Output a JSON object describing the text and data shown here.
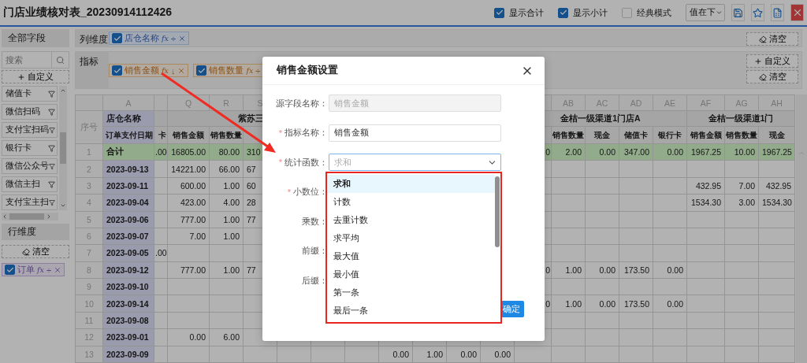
{
  "header": {
    "title": "门店业绩核对表_20230914112426",
    "options": [
      {
        "label": "显示合计",
        "checked": true
      },
      {
        "label": "显示小计",
        "checked": true
      },
      {
        "label": "经典模式",
        "checked": false
      }
    ],
    "value_position": {
      "value": "值在下"
    }
  },
  "sidebar": {
    "title": "全部字段",
    "search": {
      "placeholder": "搜索"
    },
    "add_button": "自定义",
    "fields": [
      {
        "label": "储值卡"
      },
      {
        "label": "微信扫码"
      },
      {
        "label": "支付宝扫码"
      },
      {
        "label": "银行卡"
      },
      {
        "label": "微信公众号"
      },
      {
        "label": "微信主扫"
      },
      {
        "label": "支付宝主扫"
      }
    ],
    "row_dimension": {
      "title": "行维度",
      "clear_button": "清空",
      "chips": [
        {
          "label": "订单",
          "checked": true,
          "formula": "fx",
          "order_mark": "÷"
        }
      ]
    }
  },
  "column_dimension": {
    "title": "列维度",
    "clear_button": "清空",
    "chips": [
      {
        "label": "店仓名称",
        "checked": true,
        "formula": "fx",
        "order_mark": "÷"
      }
    ]
  },
  "metrics": {
    "title": "指标",
    "add_button": "自定义",
    "clear_button": "清空",
    "chips": [
      {
        "label": "销售金额",
        "checked": true,
        "formula": "fx",
        "order_mark": "↓"
      },
      {
        "label": "销售数量",
        "checked": true,
        "formula": "fx",
        "order_mark": "÷"
      }
    ]
  },
  "table": {
    "seq_header": "序号",
    "columns": [
      {
        "letter": "A",
        "kind": "key",
        "header": "订单支付日期"
      },
      {
        "kind": "tail",
        "header": "卡"
      },
      {
        "letter": "Q",
        "kind": "value",
        "header": "销售金额"
      },
      {
        "letter": "R",
        "kind": "value",
        "header": "销售数量"
      },
      {
        "letter": "S",
        "kind": "head"
      },
      {
        "kind": "value"
      },
      {
        "kind": "value"
      },
      {
        "kind": "value"
      },
      {
        "kind": "value"
      },
      {
        "kind": "value"
      },
      {
        "kind": "value"
      },
      {
        "kind": "value"
      },
      {
        "kind": "tail"
      },
      {
        "letter": "AB",
        "kind": "value",
        "header": "销售数量"
      },
      {
        "letter": "AC",
        "kind": "value",
        "header": "现金"
      },
      {
        "letter": "AD",
        "kind": "value",
        "header": "储值卡"
      },
      {
        "letter": "AE",
        "kind": "value",
        "header": "银行卡"
      },
      {
        "letter": "AF",
        "kind": "value",
        "header": "销售金额"
      },
      {
        "letter": "AG",
        "kind": "value",
        "header": "销售数量"
      },
      {
        "letter": "AH",
        "kind": "value",
        "header": "现金"
      }
    ],
    "groups": [
      {
        "label": "店仓名称"
      },
      {
        "label": "紫苏三"
      },
      {
        "label": "金桔一级渠道1门店A"
      },
      {
        "label": "金桔一级渠道1门"
      }
    ],
    "rows": [
      {
        "seq": "1",
        "kind": "total",
        "cells": [
          "合计",
          ".00",
          "16805.00",
          "80.00",
          "310",
          null,
          null,
          null,
          null,
          null,
          null,
          null,
          "0",
          "2.00",
          "0.00",
          "347.00",
          "0.00",
          "1967.25",
          "10.00",
          "1967.25"
        ]
      },
      {
        "seq": "2",
        "kind": "data",
        "cells": [
          "2023-09-13",
          null,
          "14221.00",
          "66.00",
          "67",
          null,
          null,
          null,
          null,
          null,
          null,
          null,
          null,
          null,
          null,
          null,
          null,
          null,
          null,
          null
        ]
      },
      {
        "seq": "3",
        "kind": "data",
        "cells": [
          "2023-09-11",
          null,
          "600.00",
          "1.00",
          "60",
          null,
          null,
          null,
          null,
          null,
          null,
          null,
          null,
          null,
          null,
          null,
          null,
          "432.95",
          "7.00",
          "432.95"
        ]
      },
      {
        "seq": "4",
        "kind": "data",
        "cells": [
          "2023-09-04",
          null,
          "423.00",
          "4.00",
          "28",
          null,
          null,
          null,
          null,
          null,
          null,
          null,
          null,
          null,
          null,
          null,
          null,
          "1534.30",
          "3.00",
          "1534.30"
        ]
      },
      {
        "seq": "5",
        "kind": "data",
        "cells": [
          "2023-09-06",
          null,
          "777.00",
          "1.00",
          "77",
          null,
          null,
          null,
          null,
          null,
          null,
          null,
          null,
          null,
          null,
          null,
          null,
          null,
          null,
          null
        ]
      },
      {
        "seq": "6",
        "kind": "data",
        "cells": [
          "2023-09-07",
          null,
          "7.00",
          "1.00",
          null,
          null,
          null,
          null,
          null,
          null,
          null,
          null,
          null,
          null,
          null,
          null,
          null,
          null,
          null,
          null
        ]
      },
      {
        "seq": "7",
        "kind": "data",
        "cells": [
          "2023-09-05",
          ".00",
          null,
          null,
          null,
          null,
          null,
          null,
          null,
          null,
          null,
          null,
          null,
          null,
          null,
          null,
          null,
          null,
          null,
          null
        ]
      },
      {
        "seq": "8",
        "kind": "data",
        "cells": [
          "2023-09-12",
          null,
          "777.00",
          "1.00",
          "77",
          null,
          null,
          null,
          null,
          null,
          null,
          null,
          "0",
          "1.00",
          "0.00",
          "173.50",
          "0.00",
          null,
          null,
          null
        ]
      },
      {
        "seq": "9",
        "kind": "data",
        "cells": [
          "2023-09-10",
          null,
          null,
          null,
          null,
          null,
          null,
          null,
          null,
          null,
          null,
          null,
          null,
          null,
          null,
          null,
          null,
          null,
          null,
          null
        ]
      },
      {
        "seq": "10",
        "kind": "data",
        "cells": [
          "2023-09-14",
          null,
          null,
          null,
          null,
          null,
          null,
          null,
          null,
          null,
          null,
          null,
          "0",
          "1.00",
          "0.00",
          "173.50",
          "0.00",
          null,
          null,
          null
        ]
      },
      {
        "seq": "11",
        "kind": "data",
        "cells": [
          "2023-09-08",
          null,
          null,
          null,
          null,
          null,
          null,
          null,
          null,
          null,
          null,
          null,
          null,
          null,
          null,
          null,
          null,
          null,
          null,
          null
        ]
      },
      {
        "seq": "12",
        "kind": "data",
        "cells": [
          "2023-09-01",
          null,
          "0.00",
          "6.00",
          null,
          null,
          null,
          null,
          null,
          null,
          null,
          null,
          null,
          null,
          null,
          null,
          null,
          null,
          null,
          null
        ]
      },
      {
        "seq": "13",
        "kind": "data",
        "cells": [
          "2023-09-09",
          null,
          null,
          null,
          null,
          null,
          null,
          null,
          "0.00",
          "1.00",
          "0.00",
          "0.00",
          null,
          null,
          null,
          null,
          null,
          null,
          null,
          null
        ]
      }
    ]
  },
  "dialog": {
    "title": "销售金额设置",
    "confirm_button": "确定",
    "fields": [
      {
        "label": "源字段名称：",
        "kind": "text",
        "value": "销售金额",
        "disabled": true
      },
      {
        "label": "指标名称：",
        "required_mark": "*",
        "kind": "text",
        "value": "销售金额",
        "disabled": false
      },
      {
        "label": "统计函数：",
        "required_mark": "*",
        "kind": "select",
        "placeholder": "求和",
        "expanded": true
      },
      {
        "label": "小数位：",
        "required_mark": "*",
        "kind": "covered"
      },
      {
        "label": "乘数：",
        "kind": "covered"
      },
      {
        "label": "前缀：",
        "kind": "covered"
      },
      {
        "label": "后缀：",
        "kind": "covered"
      }
    ],
    "options": [
      {
        "label": "求和",
        "selected": true
      },
      {
        "label": "计数",
        "selected": false
      },
      {
        "label": "去重计数",
        "selected": false
      },
      {
        "label": "求平均",
        "selected": false
      },
      {
        "label": "最大值",
        "selected": false
      },
      {
        "label": "最小值",
        "selected": false
      },
      {
        "label": "第一条",
        "selected": false
      },
      {
        "label": "最后一条",
        "selected": false
      }
    ]
  }
}
